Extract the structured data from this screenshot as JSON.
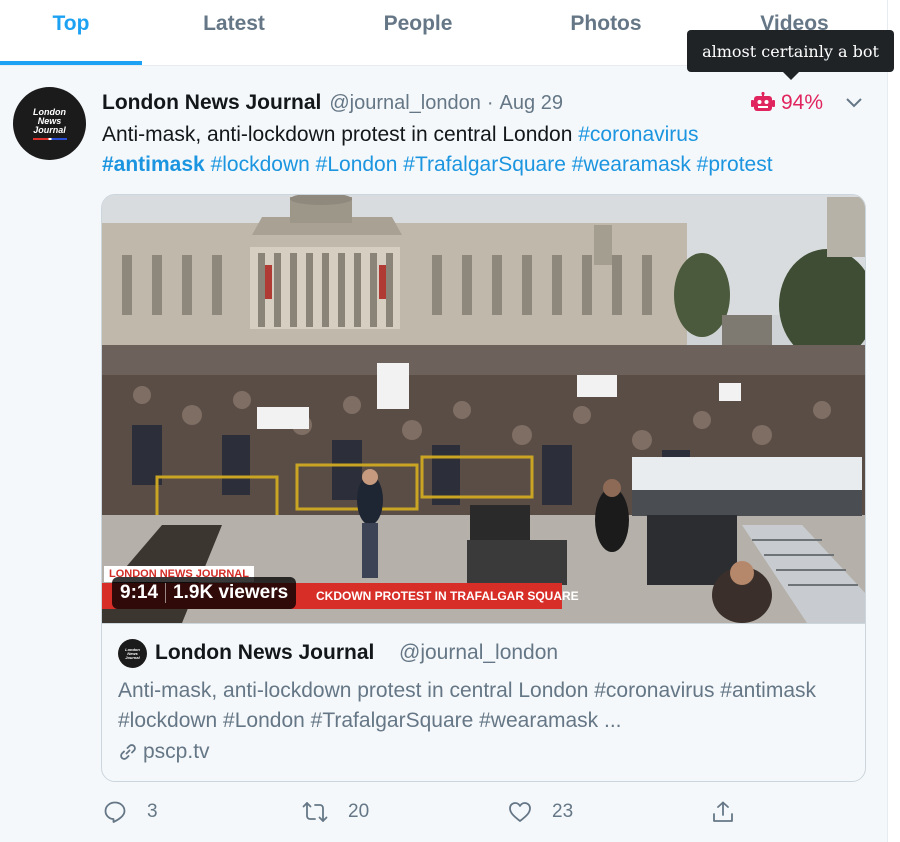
{
  "tabs": [
    {
      "label": "Top",
      "active": true
    },
    {
      "label": "Latest",
      "active": false
    },
    {
      "label": "People",
      "active": false
    },
    {
      "label": "Photos",
      "active": false
    },
    {
      "label": "Videos",
      "active": false
    }
  ],
  "tooltip": {
    "text": "almost certainly a bot"
  },
  "tweet": {
    "avatar_text": [
      "London",
      "News",
      "Journal"
    ],
    "author_name": "London News Journal",
    "handle": "@journal_london",
    "separator": "·",
    "date": "Aug 29",
    "bot_score": "94%",
    "text_plain": "Anti-mask, anti-lockdown protest in central London ",
    "hashtags": [
      "#coronavirus",
      "#antimask",
      "#lockdown",
      "#London",
      "#TrafalgarSquare",
      "#wearamask",
      "#protest"
    ]
  },
  "video": {
    "station_label": "LONDON NEWS JOURNAL",
    "headline": "CKDOWN PROTEST IN TRAFALGAR SQUARE",
    "duration": "9:14",
    "viewers": "1.9K viewers"
  },
  "card": {
    "name": "London News Journal",
    "handle": "@journal_london",
    "text": "Anti-mask, anti-lockdown protest in central London #coronavirus #antimask #lockdown #London #TrafalgarSquare #wearamask ...",
    "link": "pscp.tv"
  },
  "actions": {
    "reply_count": "3",
    "retweet_count": "20",
    "like_count": "23"
  },
  "colors": {
    "accent": "#1da1f2",
    "hashtag": "#1b95e0",
    "bot_red": "#e0245e",
    "muted": "#657786",
    "tweet_bg": "#f5f8fa"
  }
}
